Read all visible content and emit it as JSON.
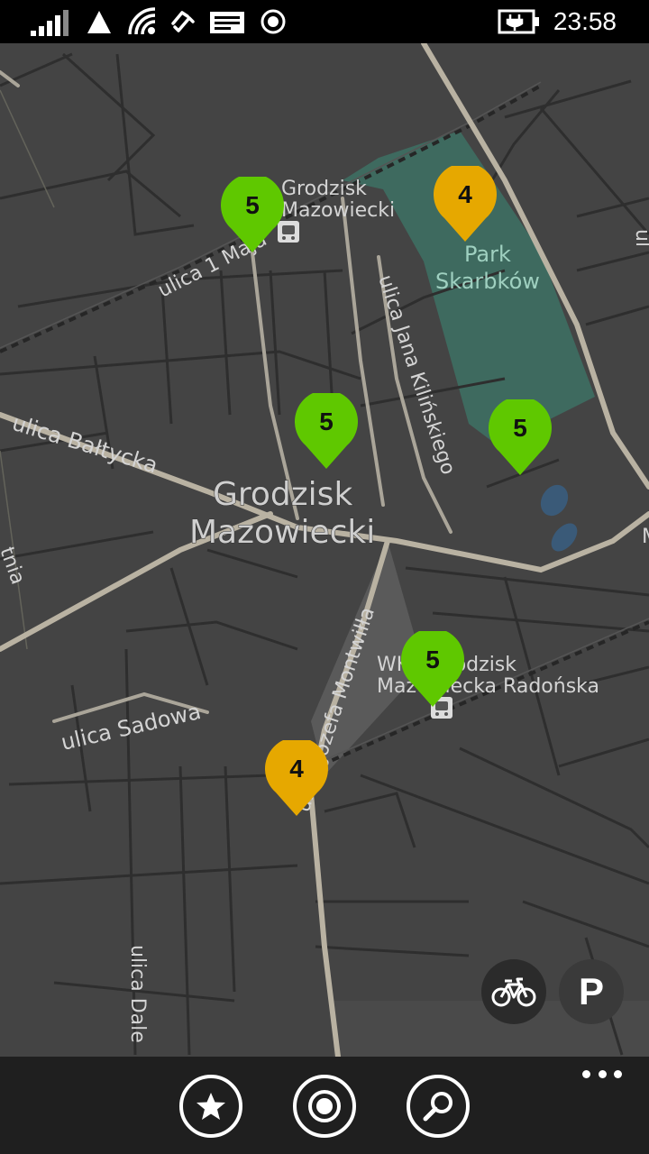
{
  "status_bar": {
    "time": "23:58",
    "icons": [
      "signal-icon",
      "data-triangle-icon",
      "wifi-icon",
      "nfc-icon",
      "message-icon",
      "location-icon",
      "battery-charging-icon"
    ]
  },
  "map": {
    "station_labels": {
      "grodzisk_top_line1": "Grodzisk",
      "grodzisk_top_line2": "Mazowiecki",
      "wkd_line1": "WKD Grodzisk",
      "wkd_line2": "Mazowiecka Radońska"
    },
    "street_labels": {
      "ulica_1_maja": "ulica 1 Maja",
      "ulica_kilinskiego": "ulica Jana Kilińskiego",
      "ulica_baltycka": "ulica Bałtycka",
      "ulica_sadowa": "ulica Sadowa",
      "ulica_montwilla": "ulica Józefa Montwiłła",
      "ulica_dale": "ulica Dale",
      "partial_left": "tnia",
      "partial_right_top": "ul",
      "partial_right_mid": "M"
    },
    "park_label_line1": "Park",
    "park_label_line2": "Skarbków",
    "city_label_line1": "Grodzisk",
    "city_label_line2": "Mazowiecki",
    "markers": [
      {
        "value": "5",
        "color": "#5fc800"
      },
      {
        "value": "4",
        "color": "#e6a800"
      },
      {
        "value": "5",
        "color": "#5fc800"
      },
      {
        "value": "5",
        "color": "#5fc800"
      },
      {
        "value": "5",
        "color": "#5fc800"
      },
      {
        "value": "4",
        "color": "#e6a800"
      }
    ],
    "overlay_buttons": {
      "parking_label": "P"
    }
  },
  "app_bar": {
    "buttons": [
      "favorites-button",
      "locate-button",
      "search-button"
    ]
  },
  "colors": {
    "map_bg": "#444444",
    "road": "#b9b2a2",
    "park": "#3e6a5f",
    "marker_green": "#5fc800",
    "marker_yellow": "#e6a800",
    "app_bar_bg": "#1f1f1f"
  }
}
